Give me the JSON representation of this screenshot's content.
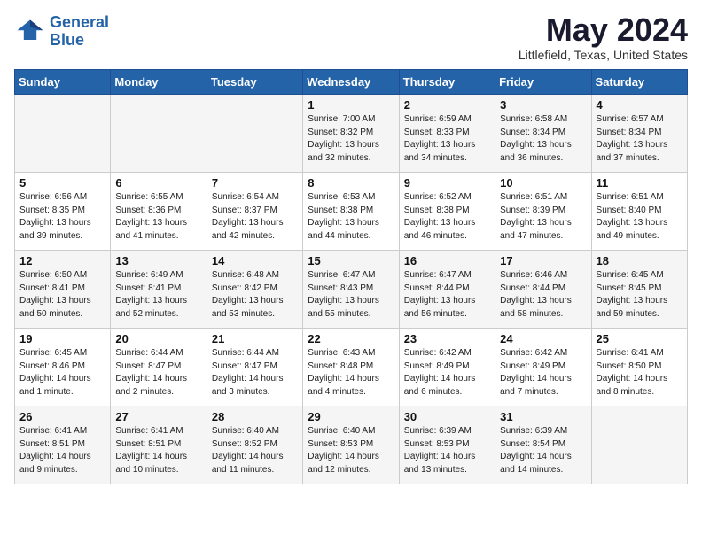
{
  "header": {
    "logo_line1": "General",
    "logo_line2": "Blue",
    "month": "May 2024",
    "location": "Littlefield, Texas, United States"
  },
  "weekdays": [
    "Sunday",
    "Monday",
    "Tuesday",
    "Wednesday",
    "Thursday",
    "Friday",
    "Saturday"
  ],
  "weeks": [
    [
      {
        "day": "",
        "info": ""
      },
      {
        "day": "",
        "info": ""
      },
      {
        "day": "",
        "info": ""
      },
      {
        "day": "1",
        "info": "Sunrise: 7:00 AM\nSunset: 8:32 PM\nDaylight: 13 hours\nand 32 minutes."
      },
      {
        "day": "2",
        "info": "Sunrise: 6:59 AM\nSunset: 8:33 PM\nDaylight: 13 hours\nand 34 minutes."
      },
      {
        "day": "3",
        "info": "Sunrise: 6:58 AM\nSunset: 8:34 PM\nDaylight: 13 hours\nand 36 minutes."
      },
      {
        "day": "4",
        "info": "Sunrise: 6:57 AM\nSunset: 8:34 PM\nDaylight: 13 hours\nand 37 minutes."
      }
    ],
    [
      {
        "day": "5",
        "info": "Sunrise: 6:56 AM\nSunset: 8:35 PM\nDaylight: 13 hours\nand 39 minutes."
      },
      {
        "day": "6",
        "info": "Sunrise: 6:55 AM\nSunset: 8:36 PM\nDaylight: 13 hours\nand 41 minutes."
      },
      {
        "day": "7",
        "info": "Sunrise: 6:54 AM\nSunset: 8:37 PM\nDaylight: 13 hours\nand 42 minutes."
      },
      {
        "day": "8",
        "info": "Sunrise: 6:53 AM\nSunset: 8:38 PM\nDaylight: 13 hours\nand 44 minutes."
      },
      {
        "day": "9",
        "info": "Sunrise: 6:52 AM\nSunset: 8:38 PM\nDaylight: 13 hours\nand 46 minutes."
      },
      {
        "day": "10",
        "info": "Sunrise: 6:51 AM\nSunset: 8:39 PM\nDaylight: 13 hours\nand 47 minutes."
      },
      {
        "day": "11",
        "info": "Sunrise: 6:51 AM\nSunset: 8:40 PM\nDaylight: 13 hours\nand 49 minutes."
      }
    ],
    [
      {
        "day": "12",
        "info": "Sunrise: 6:50 AM\nSunset: 8:41 PM\nDaylight: 13 hours\nand 50 minutes."
      },
      {
        "day": "13",
        "info": "Sunrise: 6:49 AM\nSunset: 8:41 PM\nDaylight: 13 hours\nand 52 minutes."
      },
      {
        "day": "14",
        "info": "Sunrise: 6:48 AM\nSunset: 8:42 PM\nDaylight: 13 hours\nand 53 minutes."
      },
      {
        "day": "15",
        "info": "Sunrise: 6:47 AM\nSunset: 8:43 PM\nDaylight: 13 hours\nand 55 minutes."
      },
      {
        "day": "16",
        "info": "Sunrise: 6:47 AM\nSunset: 8:44 PM\nDaylight: 13 hours\nand 56 minutes."
      },
      {
        "day": "17",
        "info": "Sunrise: 6:46 AM\nSunset: 8:44 PM\nDaylight: 13 hours\nand 58 minutes."
      },
      {
        "day": "18",
        "info": "Sunrise: 6:45 AM\nSunset: 8:45 PM\nDaylight: 13 hours\nand 59 minutes."
      }
    ],
    [
      {
        "day": "19",
        "info": "Sunrise: 6:45 AM\nSunset: 8:46 PM\nDaylight: 14 hours\nand 1 minute."
      },
      {
        "day": "20",
        "info": "Sunrise: 6:44 AM\nSunset: 8:47 PM\nDaylight: 14 hours\nand 2 minutes."
      },
      {
        "day": "21",
        "info": "Sunrise: 6:44 AM\nSunset: 8:47 PM\nDaylight: 14 hours\nand 3 minutes."
      },
      {
        "day": "22",
        "info": "Sunrise: 6:43 AM\nSunset: 8:48 PM\nDaylight: 14 hours\nand 4 minutes."
      },
      {
        "day": "23",
        "info": "Sunrise: 6:42 AM\nSunset: 8:49 PM\nDaylight: 14 hours\nand 6 minutes."
      },
      {
        "day": "24",
        "info": "Sunrise: 6:42 AM\nSunset: 8:49 PM\nDaylight: 14 hours\nand 7 minutes."
      },
      {
        "day": "25",
        "info": "Sunrise: 6:41 AM\nSunset: 8:50 PM\nDaylight: 14 hours\nand 8 minutes."
      }
    ],
    [
      {
        "day": "26",
        "info": "Sunrise: 6:41 AM\nSunset: 8:51 PM\nDaylight: 14 hours\nand 9 minutes."
      },
      {
        "day": "27",
        "info": "Sunrise: 6:41 AM\nSunset: 8:51 PM\nDaylight: 14 hours\nand 10 minutes."
      },
      {
        "day": "28",
        "info": "Sunrise: 6:40 AM\nSunset: 8:52 PM\nDaylight: 14 hours\nand 11 minutes."
      },
      {
        "day": "29",
        "info": "Sunrise: 6:40 AM\nSunset: 8:53 PM\nDaylight: 14 hours\nand 12 minutes."
      },
      {
        "day": "30",
        "info": "Sunrise: 6:39 AM\nSunset: 8:53 PM\nDaylight: 14 hours\nand 13 minutes."
      },
      {
        "day": "31",
        "info": "Sunrise: 6:39 AM\nSunset: 8:54 PM\nDaylight: 14 hours\nand 14 minutes."
      },
      {
        "day": "",
        "info": ""
      }
    ]
  ]
}
